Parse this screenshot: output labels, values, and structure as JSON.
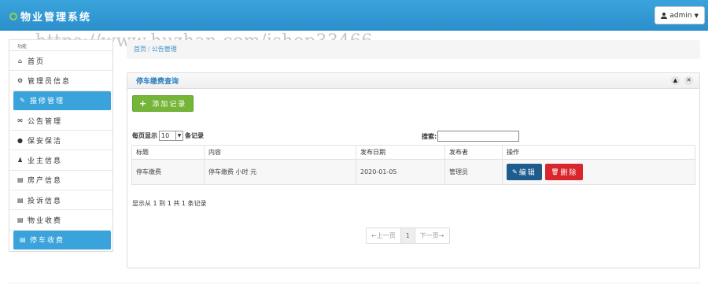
{
  "app": {
    "title": "物业管理系统",
    "user_label": "admin"
  },
  "watermark": "https://www.huzhan.com/ishop33466",
  "sidebar": {
    "title": "功能",
    "items": [
      {
        "label": "首页",
        "icon": "home-icon",
        "active": false
      },
      {
        "label": "管理员信息",
        "icon": "gear-icon",
        "active": false
      },
      {
        "label": "报修管理",
        "icon": "wrench-icon",
        "active": true
      },
      {
        "label": "公告管理",
        "icon": "envelope-icon",
        "active": false
      },
      {
        "label": "保安保洁",
        "icon": "info-icon",
        "active": false
      },
      {
        "label": "业主信息",
        "icon": "user-icon",
        "active": false
      },
      {
        "label": "房产信息",
        "icon": "list-icon",
        "active": false
      },
      {
        "label": "投诉信息",
        "icon": "list-icon",
        "active": false
      },
      {
        "label": "物业收费",
        "icon": "list-icon",
        "active": false
      },
      {
        "label": "停车收费",
        "icon": "list-icon",
        "active": true
      }
    ]
  },
  "breadcrumb": {
    "home": "首页",
    "current": "公告管理"
  },
  "panel": {
    "title": "停车缴费查询",
    "add_label": "添加记录",
    "length_prefix": "每页显示",
    "length_value": "10",
    "length_suffix": "条记录",
    "search_label": "搜索:",
    "search_value": "",
    "columns": [
      "标题",
      "内容",
      "发布日期",
      "发布者",
      "操作"
    ],
    "rows": [
      {
        "title": "停车缴费",
        "content": "停车缴费   小时   元",
        "date": "2020-01-05",
        "author": "管理员"
      }
    ],
    "edit_label": "编辑",
    "delete_label": "删除",
    "info": "显示从 1 到 1 共 1 条记录",
    "pager": {
      "prev": "←上一页",
      "page": "1",
      "next": "下一页→"
    }
  },
  "colors": {
    "header": "#2b8fcb",
    "active_item": "#3aa3dc",
    "add_button": "#75b537",
    "edit_button": "#1f5c8e",
    "delete_button": "#d8262c"
  }
}
